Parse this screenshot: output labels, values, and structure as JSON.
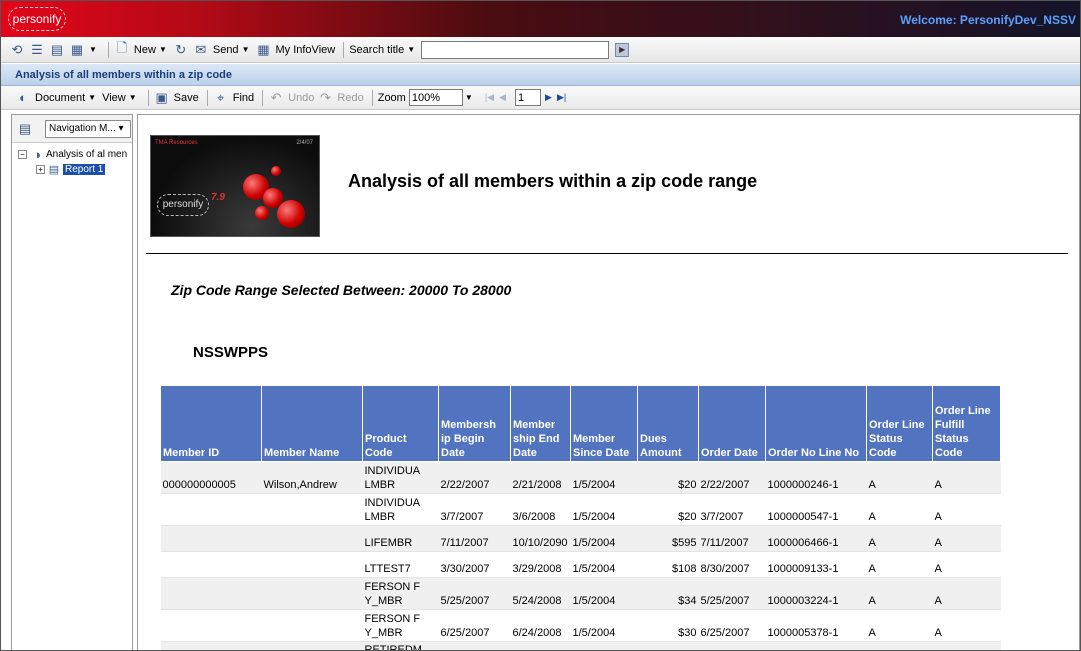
{
  "header": {
    "logo_text": "personify",
    "welcome": "Welcome: PersonifyDev_NSSV"
  },
  "toolbar1": {
    "new_label": "New",
    "send_label": "Send",
    "infoview_label": "My InfoView",
    "search_label": "Search title",
    "search_value": ""
  },
  "window_title": "Analysis of all members within a zip code",
  "toolbar2": {
    "document_label": "Document",
    "view_label": "View",
    "save_label": "Save",
    "find_label": "Find",
    "undo_label": "Undo",
    "redo_label": "Redo",
    "zoom_label": "Zoom",
    "zoom_value": "100%",
    "page_value": "1"
  },
  "nav": {
    "select_label": "Navigation M...",
    "tree_root": "Analysis of al men",
    "tree_child": "Report 1"
  },
  "report": {
    "thumb_header": "TMA Resources",
    "thumb_number": "2/4/07",
    "thumb_logo": "personify",
    "thumb_version": "7.9",
    "title": "Analysis of all members within a zip code range",
    "zip_range": "Zip Code Range Selected Between: 20000  To  28000",
    "org": "NSSWPPS",
    "columns": [
      "Member ID",
      "Member Name",
      "Product Code",
      "Membersh ip Begin Date",
      "Member ship End Date",
      "Member Since Date",
      "Dues Amount",
      "Order Date",
      "Order No Line No",
      "Order Line Status Code",
      "Order Line Fulfill Status Code"
    ],
    "rows": [
      [
        "000000000005",
        "Wilson,Andrew",
        "INDIVIDUA LMBR",
        "2/22/2007",
        "2/21/2008",
        "1/5/2004",
        "$20",
        "2/22/2007",
        "1000000246-1",
        "A",
        "A"
      ],
      [
        "",
        "",
        "INDIVIDUA LMBR",
        "3/7/2007",
        "3/6/2008",
        "1/5/2004",
        "$20",
        "3/7/2007",
        "1000000547-1",
        "A",
        "A"
      ],
      [
        "",
        "",
        "LIFEMBR",
        "7/11/2007",
        "10/10/2090",
        "1/5/2004",
        "$595",
        "7/11/2007",
        "1000006466-1",
        "A",
        "A"
      ],
      [
        "",
        "",
        "LTTEST7",
        "3/30/2007",
        "3/29/2008",
        "1/5/2004",
        "$108",
        "8/30/2007",
        "1000009133-1",
        "A",
        "A"
      ],
      [
        "",
        "",
        "FERSON F Y_MBR",
        "5/25/2007",
        "5/24/2008",
        "1/5/2004",
        "$34",
        "5/25/2007",
        "1000003224-1",
        "A",
        "A"
      ],
      [
        "",
        "",
        "FERSON F Y_MBR",
        "6/25/2007",
        "6/24/2008",
        "1/5/2004",
        "$30",
        "6/25/2007",
        "1000005378-1",
        "A",
        "A"
      ],
      [
        "",
        "",
        "RETIREDM",
        "",
        "",
        "",
        "",
        "",
        "",
        "",
        ""
      ]
    ]
  }
}
